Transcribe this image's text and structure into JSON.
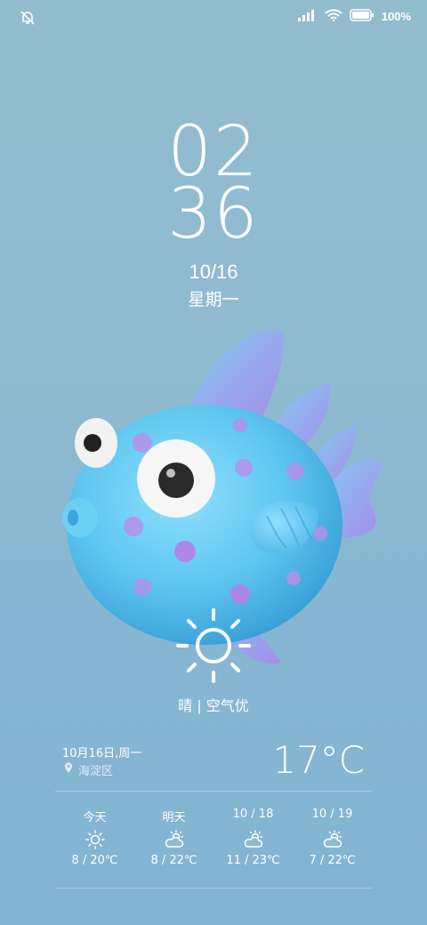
{
  "status_bar": {
    "battery_text": "100%",
    "icons": [
      "bell-off-icon",
      "signal-icon",
      "wifi-icon",
      "battery-icon"
    ]
  },
  "clock": {
    "hours": "02",
    "minutes": "36"
  },
  "date": {
    "numeric": "10/16",
    "weekday": "星期一"
  },
  "current_weather": {
    "icon": "sun-icon",
    "condition": "晴 | 空气优",
    "full_date": "10月16日,周一",
    "location": "海淀区",
    "temperature": "17°C"
  },
  "forecast": [
    {
      "day": "今天",
      "icon": "sun-icon",
      "range": "8 / 20℃"
    },
    {
      "day": "明天",
      "icon": "partly-cloudy-icon",
      "range": "8 / 22℃"
    },
    {
      "day": "10 / 18",
      "icon": "partly-cloudy-icon",
      "range": "11 / 23℃"
    },
    {
      "day": "10 / 19",
      "icon": "partly-cloudy-icon",
      "range": "7 / 22℃"
    }
  ],
  "colors": {
    "background": "#8fbad0",
    "fish_body": "#5fc8ee",
    "fish_fin": "#9a8ee8",
    "text": "#ffffff"
  }
}
